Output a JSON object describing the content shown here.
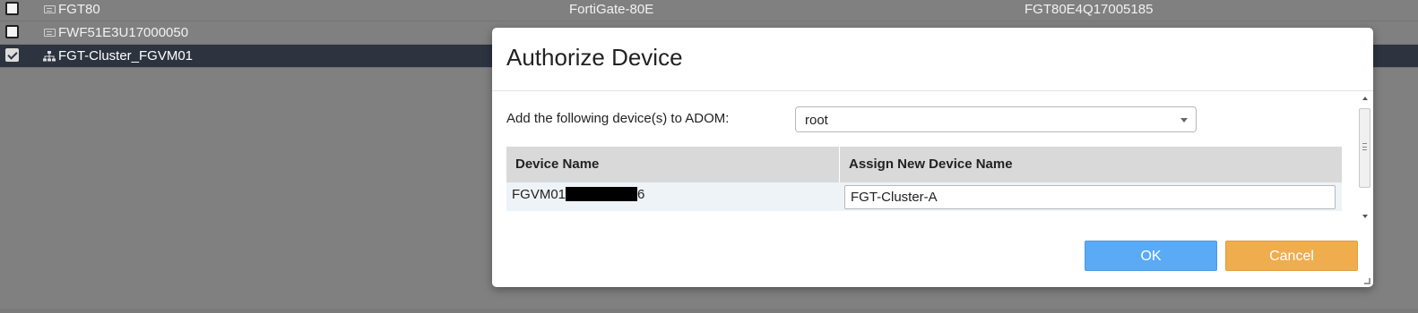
{
  "background_table": {
    "rows": [
      {
        "name": "FGT80",
        "model": "FortiGate-80E",
        "serial": "FGT80E4Q17005185",
        "checked": false,
        "icon": "device-icon"
      },
      {
        "name": "FWF51E3U17000050",
        "model": "",
        "serial": "",
        "checked": false,
        "icon": "device-icon"
      },
      {
        "name": "FGT-Cluster_FGVM01",
        "model": "",
        "serial": "",
        "checked": true,
        "icon": "cluster-icon"
      }
    ]
  },
  "dialog": {
    "title": "Authorize Device",
    "adom_label": "Add the following device(s) to ADOM:",
    "adom_selected": "root",
    "table": {
      "col_device_name": "Device Name",
      "col_assign_name": "Assign New Device Name",
      "rows": [
        {
          "device_name_prefix": "FGVM01",
          "device_name_suffix": "6",
          "new_name": "FGT-Cluster-A"
        }
      ]
    },
    "ok_label": "OK",
    "cancel_label": "Cancel"
  },
  "colors": {
    "overlay": "#808080",
    "selected_row": "#2d3440",
    "ok_button": "#5aaaf5",
    "cancel_button": "#f0ad4e"
  }
}
